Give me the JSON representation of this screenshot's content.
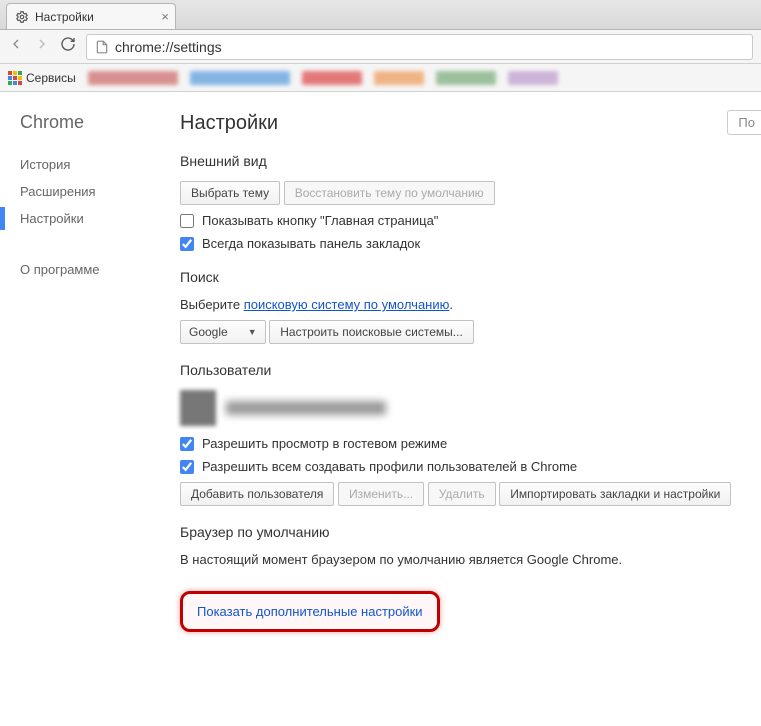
{
  "tab": {
    "title": "Настройки"
  },
  "omnibox": {
    "url": "chrome://settings"
  },
  "bookmarks": {
    "apps_label": "Сервисы"
  },
  "sidebar": {
    "brand": "Chrome",
    "history": "История",
    "extensions": "Расширения",
    "settings": "Настройки",
    "about": "О программе"
  },
  "search_box": {
    "placeholder": "По"
  },
  "settings": {
    "title": "Настройки",
    "appearance": {
      "heading": "Внешний вид",
      "choose_theme_btn": "Выбрать тему",
      "reset_theme_btn": "Восстановить тему по умолчанию",
      "show_home_btn": "Показывать кнопку \"Главная страница\"",
      "always_show_bookmarks": "Всегда показывать панель закладок"
    },
    "search": {
      "heading": "Поиск",
      "description_prefix": "Выберите ",
      "description_link": "поисковую систему по умолчанию",
      "selected_engine": "Google",
      "manage_btn": "Настроить поисковые системы..."
    },
    "users": {
      "heading": "Пользователи",
      "allow_guest": "Разрешить просмотр в гостевом режиме",
      "allow_add_profiles": "Разрешить всем создавать профили пользователей в Chrome",
      "add_btn": "Добавить пользователя",
      "edit_btn": "Изменить...",
      "delete_btn": "Удалить",
      "import_btn": "Импортировать закладки и настройки"
    },
    "default_browser": {
      "heading": "Браузер по умолчанию",
      "status": "В настоящий момент браузером по умолчанию является Google Chrome."
    },
    "advanced_link": "Показать дополнительные настройки"
  }
}
